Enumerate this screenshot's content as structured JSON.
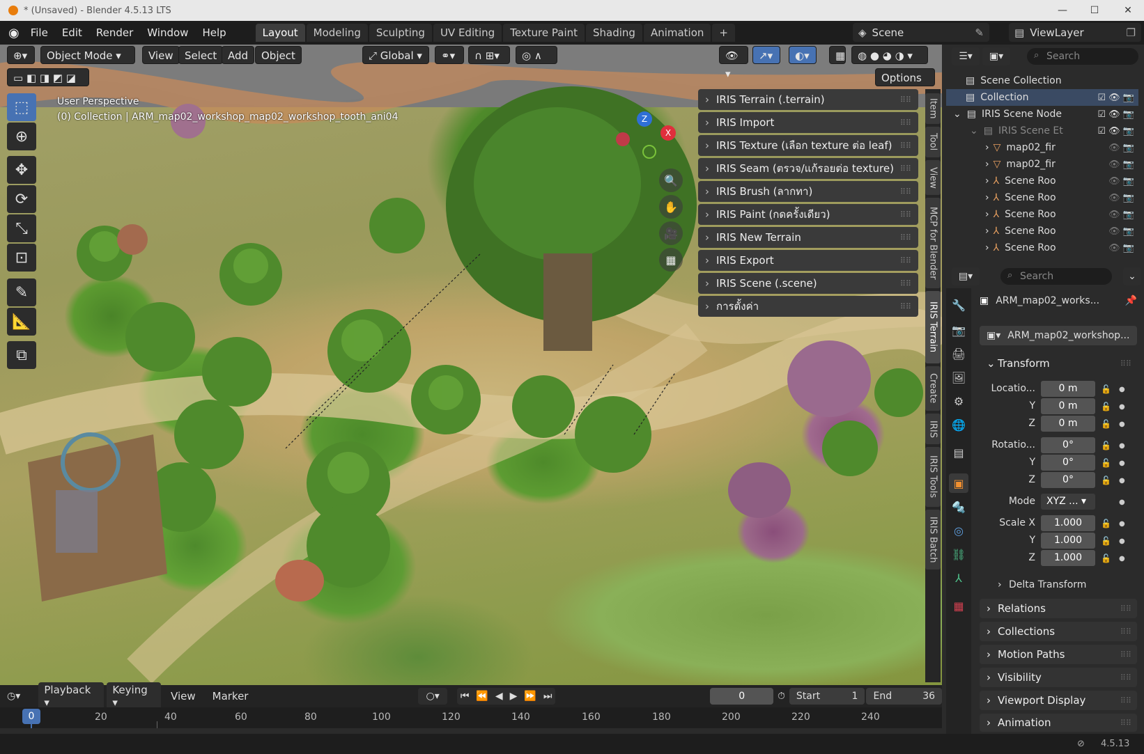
{
  "window": {
    "title": "* (Unsaved) - Blender 4.5.13 LTS"
  },
  "menu": [
    "File",
    "Edit",
    "Render",
    "Window",
    "Help"
  ],
  "workspaces": [
    "Layout",
    "Modeling",
    "Sculpting",
    "UV Editing",
    "Texture Paint",
    "Shading",
    "Animation"
  ],
  "workspace_add": "+",
  "scene": {
    "name": "Scene",
    "view_layer": "ViewLayer"
  },
  "viewport": {
    "mode": "Object Mode",
    "view": "View",
    "select": "Select",
    "add": "Add",
    "object": "Object",
    "orientation": "Global",
    "options": "Options",
    "perspective": "User Perspective",
    "collection_info": "(0) Collection | ARM_map02_workshop_map02_workshop_tooth_ani04"
  },
  "npanel": {
    "items": [
      "IRIS Terrain (.terrain)",
      "IRIS Import",
      "IRIS Texture (เลือก texture ต่อ leaf)",
      "IRIS Seam (ตรวจ/แก้รอยต่อ texture)",
      "IRIS Brush (ลากทา)",
      "IRIS Paint (กดครั้งเดียว)",
      "IRIS New Terrain",
      "IRIS Export",
      "IRIS Scene (.scene)",
      "การตั้งค่า"
    ],
    "tabs": [
      "Item",
      "Tool",
      "View",
      "MCP for Blender",
      "IRIS Terrain",
      "Create",
      "IRIS",
      "IRIS Tools",
      "IRIS Batch"
    ]
  },
  "gizmo": {
    "z": "Z",
    "x": "X",
    "y": "Y"
  },
  "timeline": {
    "playback": "Playback",
    "keying": "Keying",
    "view": "View",
    "marker": "Marker",
    "current_frame": "0",
    "start_label": "Start",
    "start": "1",
    "end_label": "End",
    "end": "36",
    "ticks": [
      "0",
      "20",
      "40",
      "60",
      "80",
      "100",
      "120",
      "140",
      "160",
      "180",
      "200",
      "220",
      "240"
    ]
  },
  "outliner": {
    "search_placeholder": "Search",
    "rows": [
      {
        "label": "Scene Collection"
      },
      {
        "label": "Collection"
      },
      {
        "label": "IRIS Scene Node"
      },
      {
        "label": "IRIS Scene Et"
      },
      {
        "label": "map02_fir"
      },
      {
        "label": "map02_fir"
      },
      {
        "label": "Scene Roo"
      },
      {
        "label": "Scene Roo"
      },
      {
        "label": "Scene Roo"
      },
      {
        "label": "Scene Roo"
      },
      {
        "label": "Scene Roo"
      }
    ]
  },
  "properties": {
    "search_placeholder": "Search",
    "object_name": "ARM_map02_works...",
    "data_name": "ARM_map02_workshop...",
    "transform": "Transform",
    "location_label": "Locatio...",
    "loc": [
      "0 m",
      "0 m",
      "0 m"
    ],
    "rotation_label": "Rotatio...",
    "rot": [
      "0°",
      "0°",
      "0°"
    ],
    "mode_label": "Mode",
    "mode": "XYZ ...",
    "scale_label": "Scale X",
    "scale": [
      "1.000",
      "1.000",
      "1.000"
    ],
    "y": "Y",
    "z": "Z",
    "delta": "Delta Transform",
    "sections": [
      "Relations",
      "Collections",
      "Motion Paths",
      "Visibility",
      "Viewport Display",
      "Animation"
    ]
  },
  "status": {
    "version": "4.5.13"
  }
}
